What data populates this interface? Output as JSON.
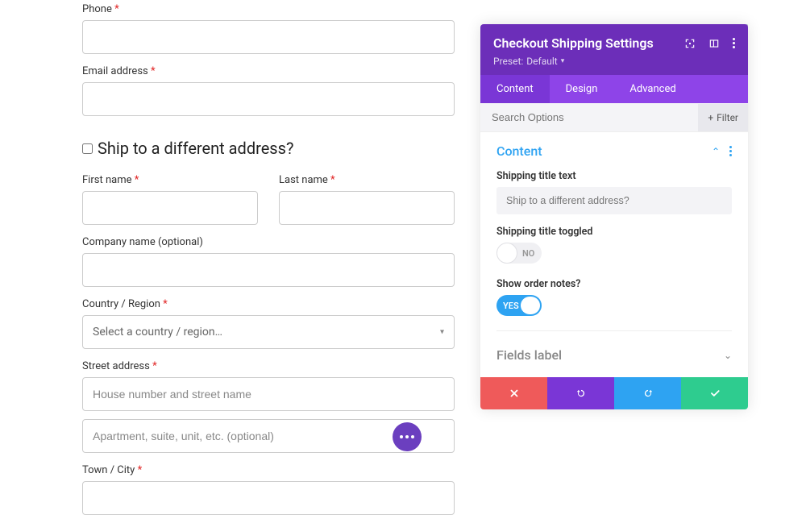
{
  "form": {
    "phone": {
      "label": "Phone"
    },
    "email": {
      "label": "Email address"
    },
    "ship_diff": {
      "label": "Ship to a different address?"
    },
    "first_name": {
      "label": "First name"
    },
    "last_name": {
      "label": "Last name"
    },
    "company": {
      "label": "Company name (optional)"
    },
    "country": {
      "label": "Country / Region",
      "placeholder": "Select a country / region…"
    },
    "street": {
      "label": "Street address",
      "placeholder1": "House number and street name",
      "placeholder2": "Apartment, suite, unit, etc. (optional)"
    },
    "town": {
      "label": "Town / City"
    },
    "required_mark": "*"
  },
  "panel": {
    "title": "Checkout Shipping Settings",
    "preset_prefix": "Preset:",
    "preset_value": "Default",
    "tabs": {
      "content": "Content",
      "design": "Design",
      "advanced": "Advanced"
    },
    "search_placeholder": "Search Options",
    "filter_label": "Filter",
    "section_content": {
      "title": "Content",
      "shipping_title_label": "Shipping title text",
      "shipping_title_value": "Ship to a different address?",
      "shipping_toggled_label": "Shipping title toggled",
      "shipping_toggled_value": "NO",
      "show_order_notes_label": "Show order notes?",
      "show_order_notes_value": "YES"
    },
    "section_fields_label": "Fields label"
  }
}
